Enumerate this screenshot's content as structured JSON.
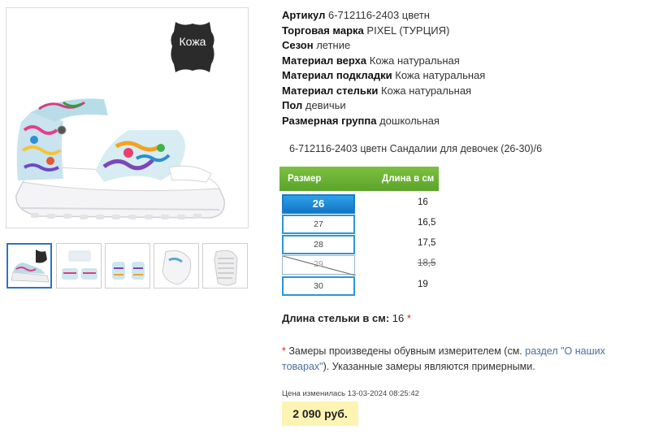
{
  "badge": {
    "text": "Кожа"
  },
  "specs": [
    {
      "key": "Артикул",
      "value": "6-712116-2403 цветн"
    },
    {
      "key": "Торговая марка",
      "value": "PIXEL (ТУРЦИЯ)"
    },
    {
      "key": "Сезон",
      "value": "летние"
    },
    {
      "key": "Материал верха",
      "value": "Кожа натуральная"
    },
    {
      "key": "Материал подкладки",
      "value": "Кожа натуральная"
    },
    {
      "key": "Материал стельки",
      "value": "Кожа натуральная"
    },
    {
      "key": "Пол",
      "value": "девичьи"
    },
    {
      "key": "Размерная группа",
      "value": "дошкольная"
    }
  ],
  "product_line": "6-712116-2403 цветн Сандалии для девочек (26-30)/6",
  "size_table": {
    "header_size": "Размер",
    "header_length": "Длина в см",
    "rows": [
      {
        "size": "26",
        "length": "16",
        "state": "selected"
      },
      {
        "size": "27",
        "length": "16,5",
        "state": "available"
      },
      {
        "size": "28",
        "length": "17,5",
        "state": "available"
      },
      {
        "size": "29",
        "length": "18,5",
        "state": "unavailable"
      },
      {
        "size": "30",
        "length": "19",
        "state": "available"
      }
    ]
  },
  "insole": {
    "label": "Длина стельки в см:",
    "value": "16",
    "mark": "*"
  },
  "note": {
    "mark": "*",
    "text_before": "Замеры произведены обувным измерителем (см.",
    "link": "раздел \"О наших товарах\"",
    "text_after": "). Указанные замеры являются примерными."
  },
  "price": {
    "changed_label": "Цена изменилась 13-03-2024 08:25:42",
    "value": "2 090 руб."
  },
  "colors": {
    "accent_blue": "#1a7cc9",
    "header_green": "#5ba42a",
    "price_bg": "#fdf4b4"
  }
}
